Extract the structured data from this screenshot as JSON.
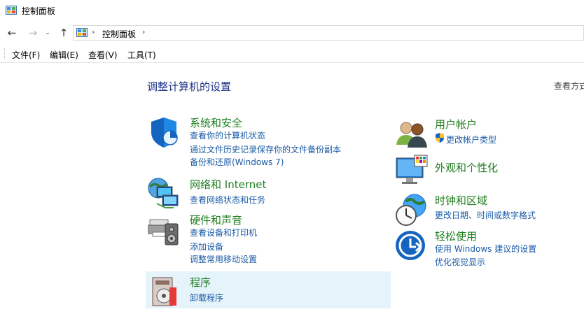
{
  "window": {
    "title": "控制面板"
  },
  "nav": {
    "back_glyph": "←",
    "forward_glyph": "→",
    "recent_glyph": "⌄",
    "up_glyph": "↑",
    "separator_glyph": "›",
    "breadcrumb": "控制面板"
  },
  "menu": {
    "items": [
      {
        "label": "文件(F)"
      },
      {
        "label": "编辑(E)"
      },
      {
        "label": "查看(V)"
      },
      {
        "label": "工具(T)"
      }
    ]
  },
  "main": {
    "heading": "调整计算机的设置",
    "view_by": "查看方式"
  },
  "categories": {
    "security": {
      "title": "系统和安全",
      "links": [
        "查看你的计算机状态",
        "通过文件历史记录保存你的文件备份副本",
        "备份和还原(Windows 7)"
      ]
    },
    "network": {
      "title": "网络和 Internet",
      "links": [
        "查看网络状态和任务"
      ]
    },
    "hardware": {
      "title": "硬件和声音",
      "links": [
        "查看设备和打印机",
        "添加设备",
        "调整常用移动设置"
      ]
    },
    "programs": {
      "title": "程序",
      "links": [
        "卸载程序"
      ]
    },
    "accounts": {
      "title": "用户帐户",
      "links": [
        "更改帐户类型"
      ]
    },
    "appearance": {
      "title": "外观和个性化",
      "links": []
    },
    "clock": {
      "title": "时钟和区域",
      "links": [
        "更改日期、时间或数字格式"
      ]
    },
    "ease": {
      "title": "轻松使用",
      "links": [
        "使用 Windows 建议的设置",
        "优化视觉显示"
      ]
    }
  },
  "colors": {
    "category_title": "#1e7d1e",
    "link": "#1a5ba6",
    "heading": "#1e3287",
    "hover_bg": "#e5f3fb"
  }
}
